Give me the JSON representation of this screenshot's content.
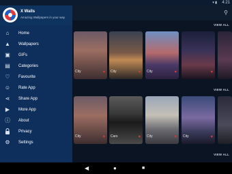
{
  "status_bar": {
    "time": "4:21",
    "icons": "▾ ▮"
  },
  "app_bar": {
    "search_icon": "search-icon"
  },
  "drawer": {
    "title": "X Walls",
    "subtitle": "Amazing Wallpapers in your way",
    "items": [
      {
        "label": "Home",
        "icon": "home-icon",
        "glyph": "⌂"
      },
      {
        "label": "Wallpapers",
        "icon": "image-icon",
        "glyph": "▲"
      },
      {
        "label": "GIFs",
        "icon": "gif-icon",
        "glyph": "▣"
      },
      {
        "label": "Categories",
        "icon": "categories-icon",
        "glyph": "▤"
      },
      {
        "label": "Favourite",
        "icon": "favourite-icon",
        "glyph": "♡"
      },
      {
        "label": "Rate App",
        "icon": "rate-icon",
        "glyph": "☺"
      },
      {
        "label": "Share App",
        "icon": "share-icon",
        "glyph": "⋖"
      },
      {
        "label": "More App",
        "icon": "more-apps-icon",
        "glyph": "▶"
      },
      {
        "label": "About",
        "icon": "info-icon",
        "glyph": "ⓘ"
      },
      {
        "label": "Privacy",
        "icon": "lock-icon",
        "glyph": "🔒"
      },
      {
        "label": "Settings",
        "icon": "settings-icon",
        "glyph": "⚙"
      }
    ]
  },
  "sections": [
    {
      "view_all": "VIEW ALL",
      "cards": [
        "City",
        "City",
        "City",
        "",
        ""
      ]
    },
    {
      "view_all": "VIEW ALL",
      "cards": [
        "City",
        "Cars",
        "City",
        "City",
        ""
      ]
    },
    {
      "view_all": "VIEW ALL"
    }
  ],
  "nav_bar": {
    "back": "◀",
    "home": "●",
    "recents": "■"
  },
  "colors": {
    "drawer_bg": "#0e2f5c",
    "content_bg": "#0b1422",
    "heart": "#d83a3a"
  }
}
